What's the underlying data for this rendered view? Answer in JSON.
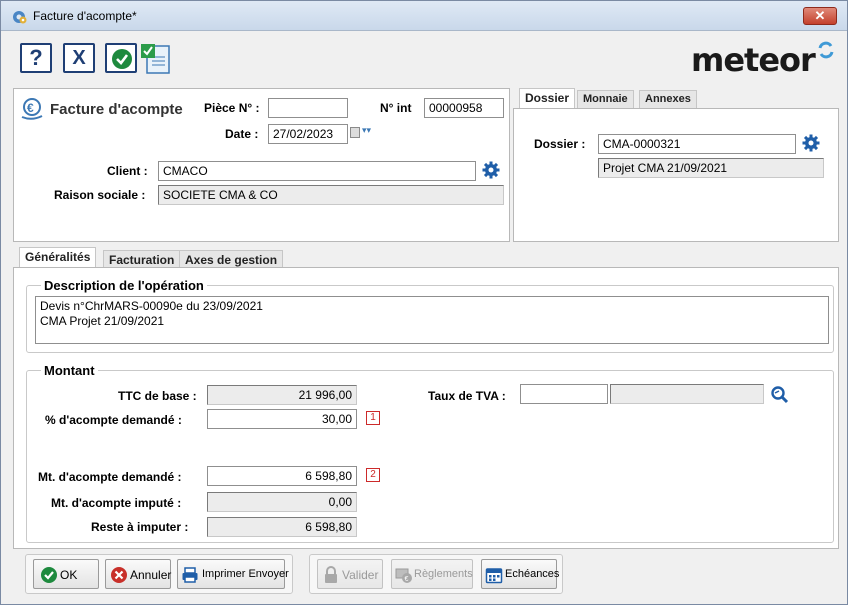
{
  "window": {
    "title": "Facture d'acompte*",
    "close_label": "✕"
  },
  "logo": {
    "text": "meteor",
    "accent": "#3f9ad6"
  },
  "header": {
    "form_title": "Facture d'acompte",
    "piece_label": "Pièce N° :",
    "piece_value": "",
    "nint_label": "N° int",
    "nint_value": "00000958",
    "date_label": "Date :",
    "date_value": "27/02/2023",
    "client_label": "Client :",
    "client_value": "CMACO",
    "raison_label": "Raison sociale :",
    "raison_value": "SOCIETE CMA & CO"
  },
  "right_tabs": [
    "Dossier",
    "Monnaie",
    "Annexes"
  ],
  "dossier": {
    "label": "Dossier :",
    "value": "CMA-0000321",
    "description": "Projet CMA 21/09/2021"
  },
  "main_tabs": [
    "Généralités",
    "Facturation",
    "Axes de gestion"
  ],
  "description": {
    "title": "Description de l'opération",
    "line1": "Devis n°ChrMARS-00090e du 23/09/2021",
    "line2": "CMA Projet 21/09/2021"
  },
  "montant": {
    "title": "Montant",
    "ttc_label": "TTC de base :",
    "ttc_value": "21 996,00",
    "tva_label": "Taux de TVA :",
    "tva_code": "",
    "tva_desc": "",
    "pct_label": "% d'acompte demandé :",
    "pct_value": "30,00",
    "marker1": "1",
    "mt_demande_label": "Mt. d'acompte demandé :",
    "mt_demande_value": "6 598,80",
    "marker2": "2",
    "mt_impute_label": "Mt. d'acompte imputé :",
    "mt_impute_value": "0,00",
    "reste_label": "Reste à imputer :",
    "reste_value": "6 598,80"
  },
  "buttons": {
    "ok": "OK",
    "annuler": "Annuler",
    "imprimer": "Imprimer Envoyer",
    "valider": "Valider",
    "reglements": "Règlements",
    "echeances": "Echéances"
  }
}
